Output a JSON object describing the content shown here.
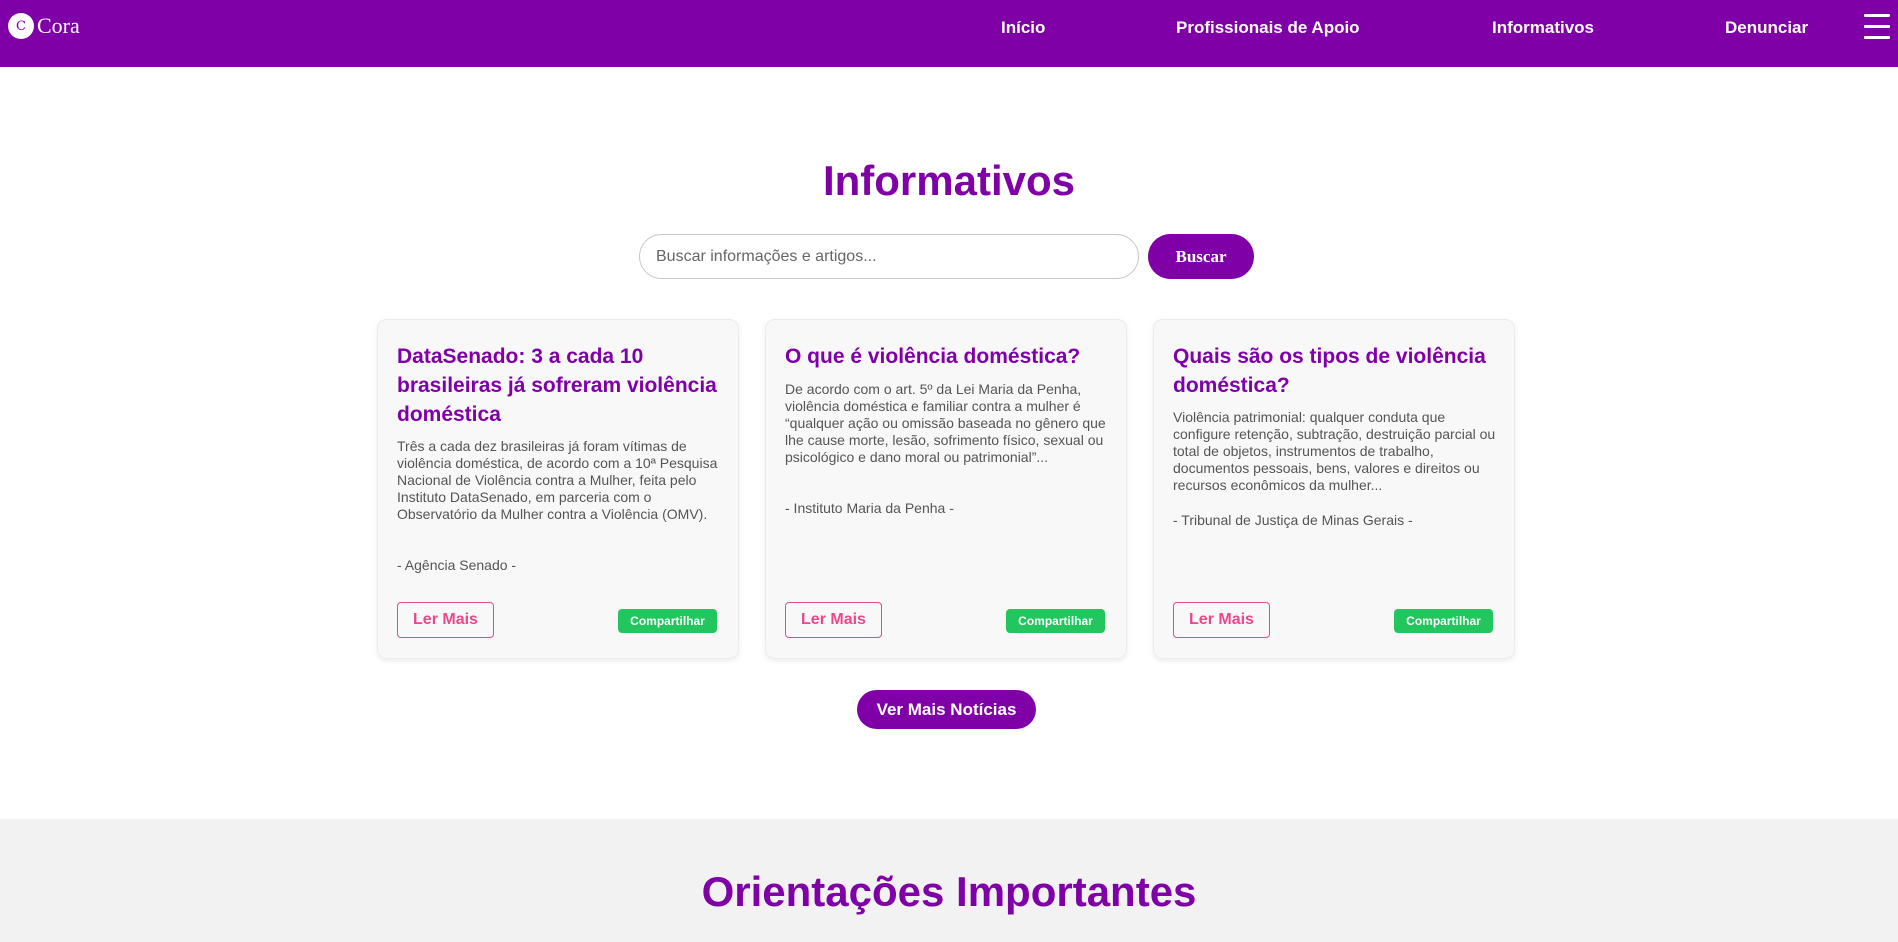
{
  "brand": {
    "initial": "C",
    "name": "Cora"
  },
  "nav": {
    "items": [
      {
        "label": "Início"
      },
      {
        "label": "Profissionais de Apoio"
      },
      {
        "label": "Informativos"
      },
      {
        "label": "Denunciar"
      }
    ]
  },
  "main": {
    "title": "Informativos",
    "search": {
      "placeholder": "Buscar informações e artigos...",
      "value": "",
      "button_label": "Buscar"
    },
    "cards": [
      {
        "title": "DataSenado: 3 a cada 10 brasileiras já sofreram violência doméstica",
        "text": "Três a cada dez brasileiras já foram vítimas de violência doméstica, de acordo com a 10ª Pesquisa Nacional de Violência contra a Mulher, feita pelo Instituto DataSenado, em parceria com o Observatório da Mulher contra a Violência (OMV).",
        "source": "- Agência Senado -",
        "read_more": "Ler Mais",
        "share": "Compartilhar"
      },
      {
        "title": "O que é violência doméstica?",
        "text": "De acordo com o art. 5º da Lei Maria da Penha, violência doméstica e familiar contra a mulher é “qualquer ação ou omissão baseada no gênero que lhe cause morte, lesão, sofrimento físico, sexual ou psicológico e dano moral ou patrimonial”...",
        "source": "- Instituto Maria da Penha -",
        "read_more": "Ler Mais",
        "share": "Compartilhar"
      },
      {
        "title": "Quais são os tipos de violência doméstica?",
        "text": "Violência patrimonial: qualquer conduta que configure retenção, subtração, destruição parcial ou total de objetos, instrumentos de trabalho, documentos pessoais, bens, valores e direitos ou recursos econômicos da mulher...",
        "source": "- Tribunal de Justiça de Minas Gerais -",
        "read_more": "Ler Mais",
        "share": "Compartilhar"
      }
    ],
    "more_news_label": "Ver Mais Notícias"
  },
  "guidance": {
    "title": "Orientações Importantes"
  },
  "colors": {
    "brand": "#8000a8",
    "accent_pink": "#e8488c",
    "share_green": "#22c55e"
  },
  "icons": {
    "menu": "hamburger-menu-icon",
    "logo": "cora-logo-icon"
  }
}
